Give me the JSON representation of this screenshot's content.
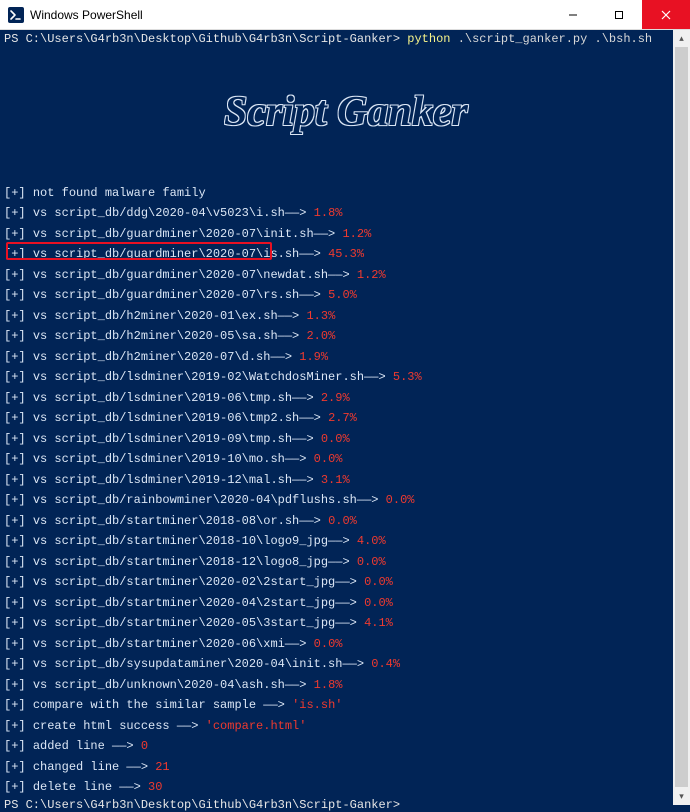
{
  "window": {
    "title": "Windows PowerShell",
    "minimize_label": "Minimize",
    "maximize_label": "Maximize",
    "close_label": "Close"
  },
  "prompt": {
    "prefix": "PS ",
    "path": "C:\\Users\\G4rb3n\\Desktop\\Github\\G4rb3n\\Script-Ganker>",
    "command_exec": "python",
    "command_args": " .\\script_ganker.py .\\bsh.sh"
  },
  "ascii_banner": "Script Ganker",
  "lines": [
    {
      "prefix": "[+] ",
      "text": "not found malware family",
      "pct": ""
    },
    {
      "prefix": "[+] ",
      "text": "vs script_db/ddg\\2020-04\\v5023\\i.sh——> ",
      "pct": "1.8%"
    },
    {
      "prefix": "[+] ",
      "text": "vs script_db/guardminer\\2020-07\\init.sh——> ",
      "pct": "1.2%"
    },
    {
      "prefix": "[+] ",
      "text": "vs script_db/guardminer\\2020-07\\is.sh——> ",
      "pct": "45.3%",
      "highlight": true
    },
    {
      "prefix": "[+] ",
      "text": "vs script_db/guardminer\\2020-07\\newdat.sh——> ",
      "pct": "1.2%"
    },
    {
      "prefix": "[+] ",
      "text": "vs script_db/guardminer\\2020-07\\rs.sh——> ",
      "pct": "5.0%"
    },
    {
      "prefix": "[+] ",
      "text": "vs script_db/h2miner\\2020-01\\ex.sh——> ",
      "pct": "1.3%"
    },
    {
      "prefix": "[+] ",
      "text": "vs script_db/h2miner\\2020-05\\sa.sh——> ",
      "pct": "2.0%"
    },
    {
      "prefix": "[+] ",
      "text": "vs script_db/h2miner\\2020-07\\d.sh——> ",
      "pct": "1.9%"
    },
    {
      "prefix": "[+] ",
      "text": "vs script_db/lsdminer\\2019-02\\WatchdosMiner.sh——> ",
      "pct": "5.3%"
    },
    {
      "prefix": "[+] ",
      "text": "vs script_db/lsdminer\\2019-06\\tmp.sh——> ",
      "pct": "2.9%"
    },
    {
      "prefix": "[+] ",
      "text": "vs script_db/lsdminer\\2019-06\\tmp2.sh——> ",
      "pct": "2.7%"
    },
    {
      "prefix": "[+] ",
      "text": "vs script_db/lsdminer\\2019-09\\tmp.sh——> ",
      "pct": "0.0%"
    },
    {
      "prefix": "[+] ",
      "text": "vs script_db/lsdminer\\2019-10\\mo.sh——> ",
      "pct": "0.0%"
    },
    {
      "prefix": "[+] ",
      "text": "vs script_db/lsdminer\\2019-12\\mal.sh——> ",
      "pct": "3.1%"
    },
    {
      "prefix": "[+] ",
      "text": "vs script_db/rainbowminer\\2020-04\\pdflushs.sh——> ",
      "pct": "0.0%"
    },
    {
      "prefix": "[+] ",
      "text": "vs script_db/startminer\\2018-08\\or.sh——> ",
      "pct": "0.0%"
    },
    {
      "prefix": "[+] ",
      "text": "vs script_db/startminer\\2018-10\\logo9_jpg——> ",
      "pct": "4.0%"
    },
    {
      "prefix": "[+] ",
      "text": "vs script_db/startminer\\2018-12\\logo8_jpg——> ",
      "pct": "0.0%"
    },
    {
      "prefix": "[+] ",
      "text": "vs script_db/startminer\\2020-02\\2start_jpg——> ",
      "pct": "0.0%"
    },
    {
      "prefix": "[+] ",
      "text": "vs script_db/startminer\\2020-04\\2start_jpg——> ",
      "pct": "0.0%"
    },
    {
      "prefix": "[+] ",
      "text": "vs script_db/startminer\\2020-05\\3start_jpg——> ",
      "pct": "4.1%"
    },
    {
      "prefix": "[+] ",
      "text": "vs script_db/startminer\\2020-06\\xmi——> ",
      "pct": "0.0%"
    },
    {
      "prefix": "[+] ",
      "text": "vs script_db/sysupdataminer\\2020-04\\init.sh——> ",
      "pct": "0.4%"
    },
    {
      "prefix": "[+] ",
      "text": "vs script_db/unknown\\2020-04\\ash.sh——> ",
      "pct": "1.8%"
    },
    {
      "prefix": "[+] ",
      "text": "compare with the similar sample ——> ",
      "quoted": "'is.sh'"
    },
    {
      "prefix": "[+] ",
      "text": "create html success ——> ",
      "quoted": "'compare.html'"
    },
    {
      "prefix": "[+] ",
      "text": "added line ——> ",
      "num": "0"
    },
    {
      "prefix": "[+] ",
      "text": "changed line ——> ",
      "num": "21"
    },
    {
      "prefix": "[+] ",
      "text": "delete line ——> ",
      "num": "30"
    }
  ],
  "prompt_bottom": {
    "prefix": "PS ",
    "path": "C:\\Users\\G4rb3n\\Desktop\\Github\\G4rb3n\\Script-Ganker>"
  },
  "watermark": ""
}
